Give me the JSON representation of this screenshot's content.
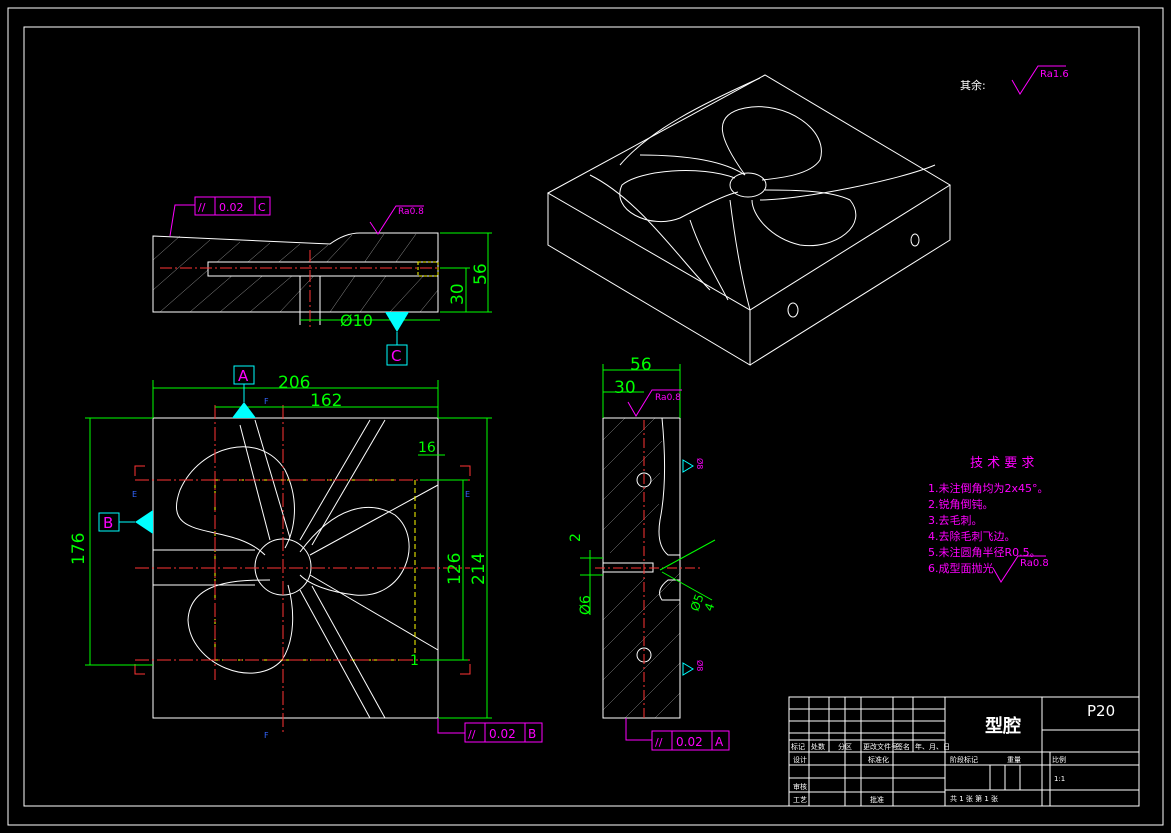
{
  "colors": {
    "background": "#000000",
    "outline": "#ffffff",
    "dimension": "#00ff00",
    "centerline": "#ff3333",
    "hidden": "#ffff00",
    "annotation": "#ff00ff",
    "datum_fill": "#00ffff"
  },
  "drawing": {
    "roughness_default_label": "其余:",
    "roughness_default_value": "Ra1.6",
    "roughness_top": "Ra0.8",
    "roughness_side": "Ra0.8",
    "roughness_req": "Ra0.8"
  },
  "top_view": {
    "tolerance_symbol": "//",
    "tolerance_value": "0.02",
    "tolerance_datum": "C",
    "dims": {
      "d1": "30",
      "d2": "56",
      "dia": "Ø10"
    },
    "datum_label": "C"
  },
  "front_view": {
    "datum_a": "A",
    "datum_b": "B",
    "dims": {
      "w1": "206",
      "w2": "162",
      "h1": "176",
      "h2": "126",
      "h3": "214",
      "d16": "16",
      "d1": "1"
    },
    "section_letter": "E",
    "section_letter2": "F",
    "tolerance_symbol": "//",
    "tolerance_value": "0.02",
    "tolerance_datum": "B"
  },
  "side_view": {
    "dims": {
      "w1": "56",
      "w2": "30",
      "d2": "2",
      "d6": "Ø6",
      "d5": "Ø5",
      "d4": "4",
      "dia8a": "Ø8",
      "dia8b": "Ø8"
    },
    "roughness": "Ra0.8",
    "tolerance_symbol": "//",
    "tolerance_value": "0.02",
    "tolerance_datum": "A"
  },
  "tech_requirements": {
    "title": "技 术 要 求",
    "items": [
      "1.未注倒角均为2x45°。",
      "2.锐角倒钝。",
      "3.去毛刺。",
      "4.去除毛刺飞边。",
      "5.未注圆角半径R0.5。",
      "6.成型面抛光"
    ]
  },
  "title_block": {
    "part_name": "型腔",
    "material": "P20",
    "header_cells": [
      "标记",
      "处数",
      "分区",
      "更改文件号",
      "签名",
      "年、月、日"
    ],
    "design": "设计",
    "standardize": "标准化",
    "stage_mark": "阶段标记",
    "weight": "重量",
    "scale_label": "比例",
    "scale_value": "1:1",
    "review": "审核",
    "process": "工艺",
    "approve": "批准",
    "sheets": "共 1 张   第 1 张"
  }
}
